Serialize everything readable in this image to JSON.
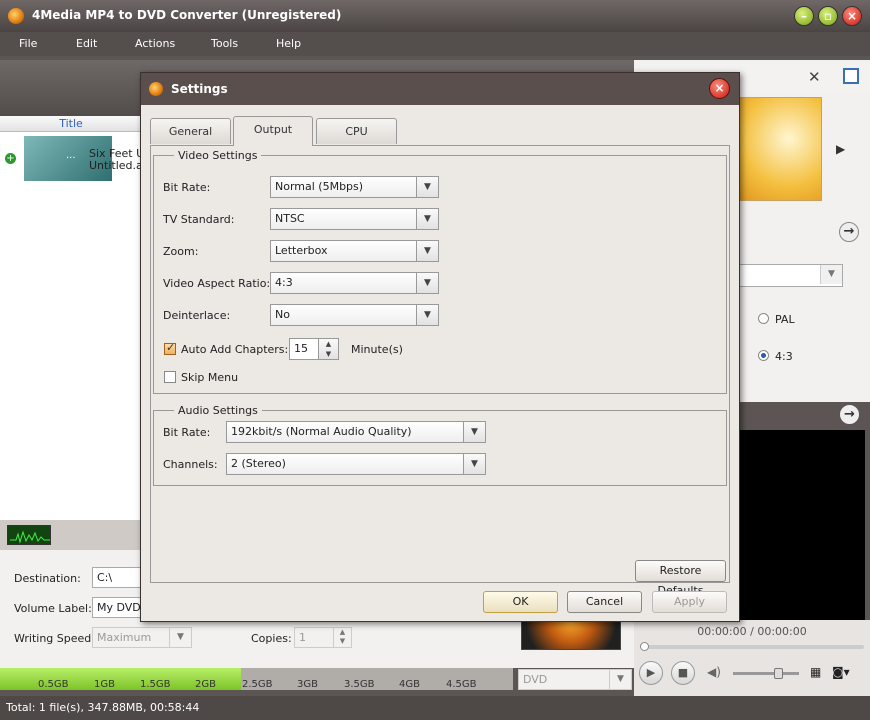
{
  "app": {
    "title": "4Media MP4 to DVD Converter (Unregistered)",
    "menu": [
      "File",
      "Edit",
      "Actions",
      "Tools",
      "Help"
    ]
  },
  "file_list": {
    "column_title": "Title",
    "file_name": "Six Feet Under",
    "file_sub": "Untitled.avi",
    "thumb_dots": "..."
  },
  "bottom": {
    "destination_label": "Destination:",
    "destination_value": "C:\\",
    "volume_label": "Volume Label:",
    "volume_value": "My DVD",
    "writing_speed_label": "Writing Speed:",
    "writing_speed_value": "Maximum",
    "copies_label": "Copies:",
    "copies_value": "1",
    "format_value": "DVD",
    "space_ticks": [
      "0.5GB",
      "1GB",
      "1.5GB",
      "2GB",
      "2.5GB",
      "3GB",
      "3.5GB",
      "4GB",
      "4.5GB"
    ],
    "space_used_fraction": 0.47
  },
  "right": {
    "pal_label": "PAL",
    "ratio_label": "4:3",
    "time_display": "00:00:00 / 00:00:00"
  },
  "status": {
    "text": "Total: 1 file(s), 347.88MB, 00:58:44"
  },
  "dialog": {
    "title": "Settings",
    "tabs": [
      "General",
      "Output",
      "CPU"
    ],
    "active_tab": "Output",
    "video": {
      "group_title": "Video Settings",
      "bitrate_label": "Bit Rate:",
      "bitrate_value": "Normal (5Mbps)",
      "tv_label": "TV Standard:",
      "tv_value": "NTSC",
      "zoom_label": "Zoom:",
      "zoom_value": "Letterbox",
      "aspect_label": "Video Aspect Ratio:",
      "aspect_value": "4:3",
      "deinterlace_label": "Deinterlace:",
      "deinterlace_value": "No",
      "auto_chapters_label": "Auto Add Chapters:",
      "auto_chapters_checked": true,
      "chapters_value": "15",
      "minutes_label": "Minute(s)",
      "skip_menu_label": "Skip Menu",
      "skip_menu_checked": false
    },
    "audio": {
      "group_title": "Audio Settings",
      "bitrate_label": "Bit Rate:",
      "bitrate_value": "192kbit/s (Normal Audio Quality)",
      "channels_label": "Channels:",
      "channels_value": "2 (Stereo)"
    },
    "buttons": {
      "restore": "Restore Defaults",
      "ok": "OK",
      "cancel": "Cancel",
      "apply": "Apply"
    }
  }
}
